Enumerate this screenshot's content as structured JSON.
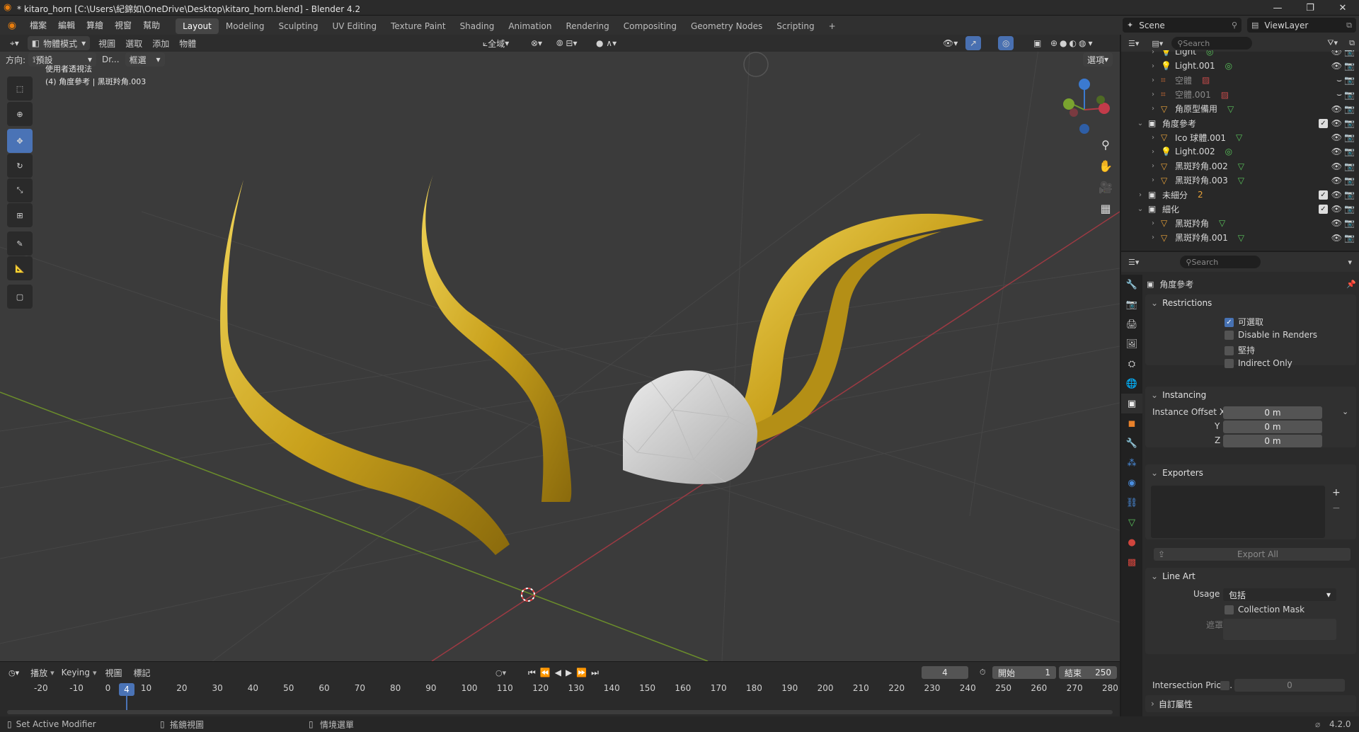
{
  "window": {
    "title": "* kitaro_horn [C:\\Users\\紀錦如\\OneDrive\\Desktop\\kitaro_horn.blend] - Blender 4.2"
  },
  "menubar": {
    "items": [
      "檔案",
      "編輯",
      "算繪",
      "視窗",
      "幫助"
    ],
    "workspaces": [
      "Layout",
      "Modeling",
      "Sculpting",
      "UV Editing",
      "Texture Paint",
      "Shading",
      "Animation",
      "Rendering",
      "Compositing",
      "Geometry Nodes",
      "Scripting"
    ],
    "active_workspace": "Layout",
    "add_tab": "+",
    "scene_label": "Scene",
    "viewlayer_label": "ViewLayer"
  },
  "viewport_header": {
    "mode": "物體模式",
    "menus": [
      "視圖",
      "選取",
      "添加",
      "物體"
    ],
    "orientation_label": "方向:",
    "orientation_value": "預設",
    "drag_label": "Dr...",
    "select_box": "框選",
    "transform_global": "全域",
    "options": "選項"
  },
  "viewport": {
    "view_name": "使用者透視法",
    "object_info": "(4) 角度參考 | 黑斑羚角.003",
    "horn_color": "#c8a21f",
    "sphere_color": "#cfcfcf"
  },
  "outliner": {
    "search_placeholder": "Search",
    "rows": [
      {
        "label": "Light",
        "indent": 2,
        "type": "light"
      },
      {
        "label": "Light.001",
        "indent": 2,
        "type": "light"
      },
      {
        "label": "空體",
        "indent": 2,
        "type": "empty",
        "dim": true
      },
      {
        "label": "空體.001",
        "indent": 2,
        "type": "empty",
        "dim": true
      },
      {
        "label": "角原型備用",
        "indent": 2,
        "type": "mesh"
      },
      {
        "label": "角度參考",
        "indent": 1,
        "type": "collection",
        "open": true
      },
      {
        "label": "Ico 球體.001",
        "indent": 2,
        "type": "mesh"
      },
      {
        "label": "Light.002",
        "indent": 2,
        "type": "light"
      },
      {
        "label": "黑斑羚角.002",
        "indent": 2,
        "type": "mesh"
      },
      {
        "label": "黑斑羚角.003",
        "indent": 2,
        "type": "mesh"
      },
      {
        "label": "未細分",
        "indent": 1,
        "type": "collection",
        "badge": "2"
      },
      {
        "label": "細化",
        "indent": 1,
        "type": "collection",
        "open": true
      },
      {
        "label": "黑斑羚角",
        "indent": 2,
        "type": "mesh"
      },
      {
        "label": "黑斑羚角.001",
        "indent": 2,
        "type": "mesh"
      }
    ]
  },
  "properties": {
    "search_placeholder": "Search",
    "collection_name": "角度參考",
    "restrictions": {
      "title": "Restrictions",
      "selectable": "可選取",
      "disable_in_renders": "Disable in Renders",
      "holdout": "堅持",
      "indirect_only": "Indirect Only"
    },
    "instancing": {
      "title": "Instancing",
      "offset_label": "Instance Offset X",
      "y_label": "Y",
      "z_label": "Z",
      "x_value": "0 m",
      "y_value": "0 m",
      "z_value": "0 m"
    },
    "exporters": {
      "title": "Exporters",
      "export_all": "Export All"
    },
    "line_art": {
      "title": "Line Art",
      "usage_label": "Usage",
      "usage_value": "包括",
      "collection_mask": "Collection Mask",
      "mask_label": "遮罩",
      "intersection_label": "Intersection Prior...",
      "intersection_value": "0"
    },
    "custom_props": "自訂屬性"
  },
  "timeline": {
    "menus": [
      "播放",
      "Keying",
      "視圖",
      "標記"
    ],
    "current_frame": "4",
    "start_label": "開始",
    "start_value": "1",
    "end_label": "結束",
    "end_value": "250",
    "ticks": [
      "-20",
      "-10",
      "0",
      "10",
      "20",
      "30",
      "40",
      "50",
      "60",
      "70",
      "80",
      "90",
      "100",
      "110",
      "120",
      "130",
      "140",
      "150",
      "160",
      "170",
      "180",
      "190",
      "200",
      "210",
      "220",
      "230",
      "240",
      "250",
      "260",
      "270",
      "280"
    ]
  },
  "statusbar": {
    "left": "Set Active Modifier",
    "middle": "搖鏡視圖",
    "right": "情境選單",
    "version": "4.2.0"
  }
}
